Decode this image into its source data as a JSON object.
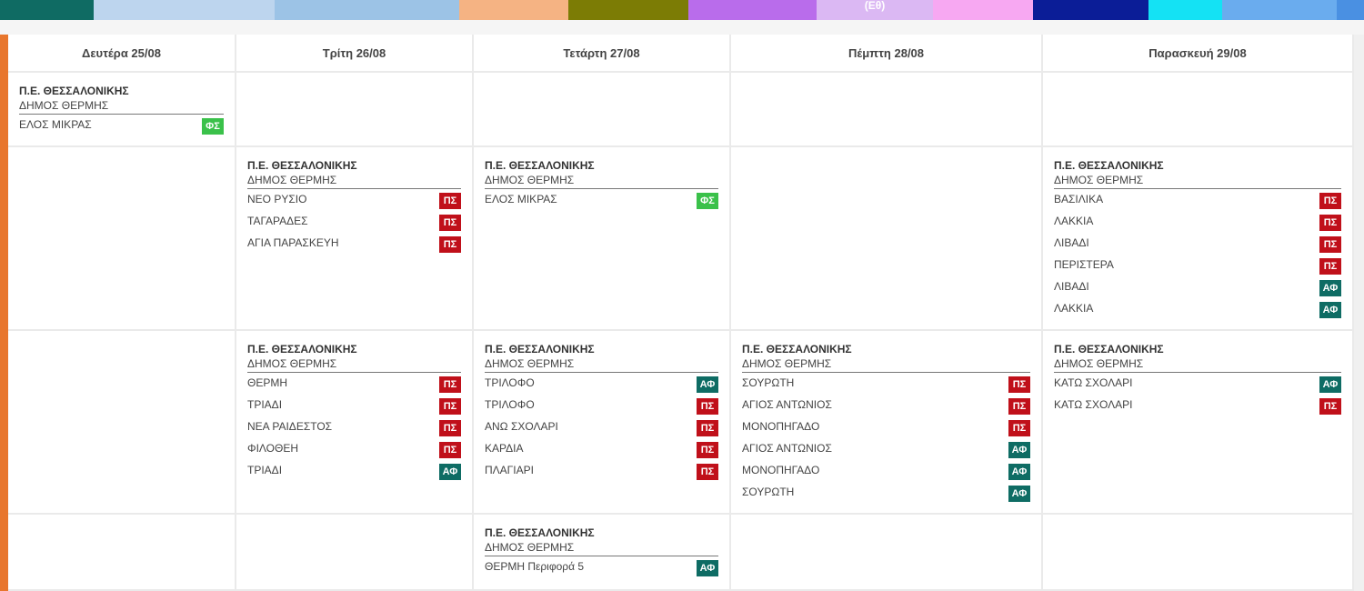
{
  "legend": [
    {
      "color": "#0f6b63",
      "label": ""
    },
    {
      "color": "#bdd5ee",
      "label": ""
    },
    {
      "color": "#9cc3e6",
      "label": ""
    },
    {
      "color": "#f5b383",
      "label": ""
    },
    {
      "color": "#7c7c05",
      "label": ""
    },
    {
      "color": "#b96ceb",
      "label": ""
    },
    {
      "color": "#dbb8f3",
      "label": "(Εθ)"
    },
    {
      "color": "#f7a8f2",
      "label": ""
    },
    {
      "color": "#0b1d97",
      "label": ""
    },
    {
      "color": "#14e2f4",
      "label": ""
    },
    {
      "color": "#6aacee",
      "label": ""
    },
    {
      "color": "#4a90e2",
      "label": ""
    }
  ],
  "days": [
    "Δευτέρα 25/08",
    "Τρίτη 26/08",
    "Τετάρτη 27/08",
    "Πέμπτη 28/08",
    "Παρασκευή 29/08"
  ],
  "badge_colors": {
    "ΠΣ": "#c0101a",
    "ΑΦ": "#0e6c64",
    "ΦΣ": "#3ac14a"
  },
  "rows": [
    [
      {
        "region": "Π.Ε. ΘΕΣΣΑΛΟΝΙΚΗΣ",
        "municipality": "ΔΗΜΟΣ ΘΕΡΜΗΣ",
        "items": [
          {
            "name": "ΕΛΟΣ ΜΙΚΡΑΣ",
            "badge": "ΦΣ"
          }
        ]
      },
      null,
      null,
      null,
      null
    ],
    [
      null,
      {
        "region": "Π.Ε. ΘΕΣΣΑΛΟΝΙΚΗΣ",
        "municipality": "ΔΗΜΟΣ ΘΕΡΜΗΣ",
        "items": [
          {
            "name": "ΝΕΟ ΡΥΣΙΟ",
            "badge": "ΠΣ"
          },
          {
            "name": "ΤΑΓΑΡΑΔΕΣ",
            "badge": "ΠΣ"
          },
          {
            "name": "ΑΓΙΑ ΠΑΡΑΣΚΕΥΗ",
            "badge": "ΠΣ"
          }
        ]
      },
      {
        "region": "Π.Ε. ΘΕΣΣΑΛΟΝΙΚΗΣ",
        "municipality": "ΔΗΜΟΣ ΘΕΡΜΗΣ",
        "items": [
          {
            "name": "ΕΛΟΣ ΜΙΚΡΑΣ",
            "badge": "ΦΣ"
          }
        ]
      },
      null,
      {
        "region": "Π.Ε. ΘΕΣΣΑΛΟΝΙΚΗΣ",
        "municipality": "ΔΗΜΟΣ ΘΕΡΜΗΣ",
        "items": [
          {
            "name": "ΒΑΣΙΛΙΚΑ",
            "badge": "ΠΣ"
          },
          {
            "name": "ΛΑΚΚΙΑ",
            "badge": "ΠΣ"
          },
          {
            "name": "ΛΙΒΑΔΙ",
            "badge": "ΠΣ"
          },
          {
            "name": "ΠΕΡΙΣΤΕΡΑ",
            "badge": "ΠΣ"
          },
          {
            "name": "ΛΙΒΑΔΙ",
            "badge": "ΑΦ"
          },
          {
            "name": "ΛΑΚΚΙΑ",
            "badge": "ΑΦ"
          }
        ]
      }
    ],
    [
      null,
      {
        "region": "Π.Ε. ΘΕΣΣΑΛΟΝΙΚΗΣ",
        "municipality": "ΔΗΜΟΣ ΘΕΡΜΗΣ",
        "items": [
          {
            "name": "ΘΕΡΜΗ",
            "badge": "ΠΣ"
          },
          {
            "name": "ΤΡΙΑΔΙ",
            "badge": "ΠΣ"
          },
          {
            "name": "ΝΕΑ ΡΑΙΔΕΣΤΟΣ",
            "badge": "ΠΣ"
          },
          {
            "name": "ΦΙΛΟΘΕΗ",
            "badge": "ΠΣ"
          },
          {
            "name": "ΤΡΙΑΔΙ",
            "badge": "ΑΦ"
          }
        ]
      },
      {
        "region": "Π.Ε. ΘΕΣΣΑΛΟΝΙΚΗΣ",
        "municipality": "ΔΗΜΟΣ ΘΕΡΜΗΣ",
        "items": [
          {
            "name": "ΤΡΙΛΟΦΟ",
            "badge": "ΑΦ"
          },
          {
            "name": "ΤΡΙΛΟΦΟ",
            "badge": "ΠΣ"
          },
          {
            "name": "ΑΝΩ ΣΧΟΛΑΡΙ",
            "badge": "ΠΣ"
          },
          {
            "name": "ΚΑΡΔΙΑ",
            "badge": "ΠΣ"
          },
          {
            "name": "ΠΛΑΓΙΑΡΙ",
            "badge": "ΠΣ"
          }
        ]
      },
      {
        "region": "Π.Ε. ΘΕΣΣΑΛΟΝΙΚΗΣ",
        "municipality": "ΔΗΜΟΣ ΘΕΡΜΗΣ",
        "items": [
          {
            "name": "ΣΟΥΡΩΤΗ",
            "badge": "ΠΣ"
          },
          {
            "name": "ΑΓΙΟΣ ΑΝΤΩΝΙΟΣ",
            "badge": "ΠΣ"
          },
          {
            "name": "ΜΟΝΟΠΗΓΑΔΟ",
            "badge": "ΠΣ"
          },
          {
            "name": "ΑΓΙΟΣ ΑΝΤΩΝΙΟΣ",
            "badge": "ΑΦ"
          },
          {
            "name": "ΜΟΝΟΠΗΓΑΔΟ",
            "badge": "ΑΦ"
          },
          {
            "name": "ΣΟΥΡΩΤΗ",
            "badge": "ΑΦ"
          }
        ]
      },
      {
        "region": "Π.Ε. ΘΕΣΣΑΛΟΝΙΚΗΣ",
        "municipality": "ΔΗΜΟΣ ΘΕΡΜΗΣ",
        "items": [
          {
            "name": "ΚΑΤΩ ΣΧΟΛΑΡΙ",
            "badge": "ΑΦ"
          },
          {
            "name": "ΚΑΤΩ ΣΧΟΛΑΡΙ",
            "badge": "ΠΣ"
          }
        ]
      }
    ],
    [
      null,
      null,
      {
        "region": "Π.Ε. ΘΕΣΣΑΛΟΝΙΚΗΣ",
        "municipality": "ΔΗΜΟΣ ΘΕΡΜΗΣ",
        "items": [
          {
            "name": "ΘΕΡΜΗ Περιφορά 5",
            "badge": "ΑΦ"
          }
        ]
      },
      null,
      null
    ]
  ]
}
